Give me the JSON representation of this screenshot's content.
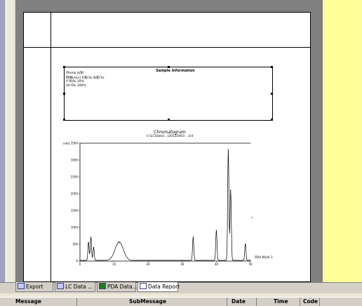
{
  "sample_info": {
    "title": "Sample Information",
    "lines": [
      "[Pump A/B]",
      "時間(min)  A液(%)  B液(%)",
      "0       90%        10%",
      "40      0%         100%"
    ]
  },
  "chromatogram": {
    "title": "Chromatogram",
    "subtitle": "C:\\LC\\Data\\...\\20150403 ...lcd"
  },
  "chart_data": {
    "type": "line",
    "title": "Chromatogram",
    "xlabel": "",
    "ylabel": "mAU",
    "ylim": [
      0,
      3500
    ],
    "xlim": [
      0,
      50
    ],
    "xticks": [
      "0",
      "10",
      "20",
      "30",
      "40",
      "50"
    ],
    "yticks": [
      "0",
      "500",
      "1000",
      "1500",
      "2000",
      "2500",
      "3000",
      "3500"
    ],
    "legend": "PDA Multi 1",
    "peaks": [
      {
        "x": 2.5,
        "y": 550
      },
      {
        "x": 3.2,
        "y": 700
      },
      {
        "x": 4.0,
        "y": 400
      },
      {
        "x": 11.5,
        "y": 550
      },
      {
        "x": 33.2,
        "y": 700
      },
      {
        "x": 40.0,
        "y": 900
      },
      {
        "x": 43.5,
        "y": 3300
      },
      {
        "x": 44.2,
        "y": 2100
      },
      {
        "x": 48.5,
        "y": 500
      },
      {
        "x": 50.5,
        "y": 1300
      }
    ]
  },
  "tabs": [
    {
      "label": "Export",
      "active": false
    },
    {
      "label": "LC Data ...",
      "active": false
    },
    {
      "label": "PDA Data...",
      "active": false
    },
    {
      "label": "Data Report",
      "active": true
    }
  ],
  "status_columns": [
    "Message",
    "SubMessage",
    "Date",
    "Time",
    "Code"
  ]
}
